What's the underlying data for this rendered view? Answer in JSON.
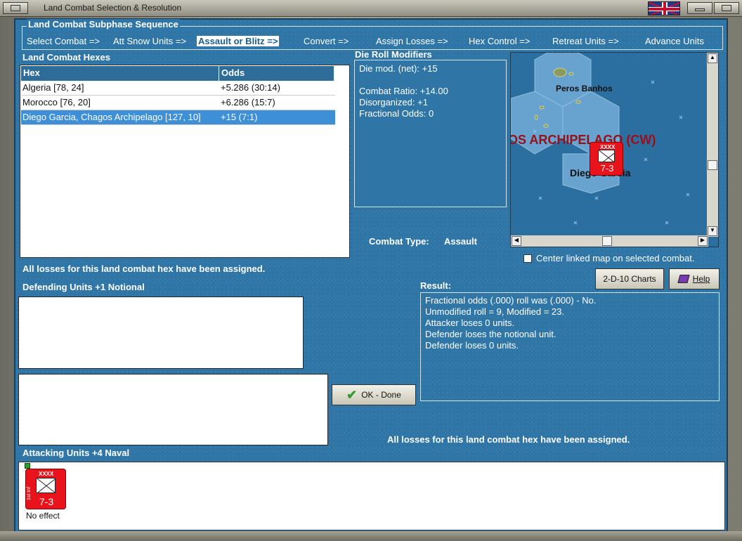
{
  "window": {
    "title": "Land Combat Selection & Resolution"
  },
  "subphase": {
    "title": "Land Combat Subphase Sequence",
    "items": [
      {
        "label": "Select Combat =>",
        "active": false
      },
      {
        "label": "Att Snow Units =>",
        "active": false
      },
      {
        "label": "Assault or Blitz =>",
        "active": true
      },
      {
        "label": "Convert =>",
        "active": false
      },
      {
        "label": "Assign Losses =>",
        "active": false
      },
      {
        "label": "Hex Control =>",
        "active": false
      },
      {
        "label": "Retreat Units =>",
        "active": false
      },
      {
        "label": "Advance Units",
        "active": false
      }
    ]
  },
  "hexes": {
    "heading": "Land Combat Hexes",
    "columns": [
      "Hex",
      "Odds"
    ],
    "rows": [
      {
        "hex": "Algeria [78, 24]",
        "odds": "+5.286 (30:14)",
        "selected": false
      },
      {
        "hex": "Morocco [76, 20]",
        "odds": "+6.286 (15:7)",
        "selected": false
      },
      {
        "hex": "Diego Garcia, Chagos Archipelago [127, 10]",
        "odds": "+15 (7:1)",
        "selected": true
      }
    ]
  },
  "die_roll": {
    "heading": "Die Roll Modifiers",
    "lines": [
      "Die mod. (net): +15",
      "",
      "Combat Ratio: +14.00",
      "Disorganized: +1",
      "Fractional Odds: 0"
    ]
  },
  "map": {
    "label_peros": "Peros Banhos",
    "label_archipelago": "OS ARCHIPELAGO (CW)",
    "label_diego": "Diego Garcia",
    "unit_strength": "7-3",
    "unit_size": "XXXX"
  },
  "combat_type": {
    "label": "Combat Type:",
    "value": "Assault"
  },
  "center_map": {
    "label": "Center linked map on selected combat.",
    "checked": false
  },
  "status_top": "All losses for this land combat hex have been assigned.",
  "defending": {
    "heading": "Defending Units +1 Notional"
  },
  "buttons": {
    "charts": "2-D-10 Charts",
    "help": "Help",
    "ok": "OK - Done"
  },
  "result": {
    "heading": "Result:",
    "lines": [
      "Fractional odds (.000) roll was (.000)  - No.",
      "Unmodified roll = 9, Modified = 23.",
      "Attacker loses 0 units.",
      "Defender loses the notional unit.",
      "Defender loses 0 units."
    ]
  },
  "status_bottom": "All losses for this land combat hex have been assigned.",
  "attacking": {
    "heading": "Attacking Units +4 Naval",
    "unit": {
      "strength": "7-3",
      "size": "XXXX",
      "side_label": "1st Inf",
      "result": "No effect"
    }
  },
  "colors": {
    "panel": "#2f76a7",
    "header": "#2e6d9a",
    "selected_row": "#3d8fd6",
    "counter_red": "#e8131b"
  }
}
